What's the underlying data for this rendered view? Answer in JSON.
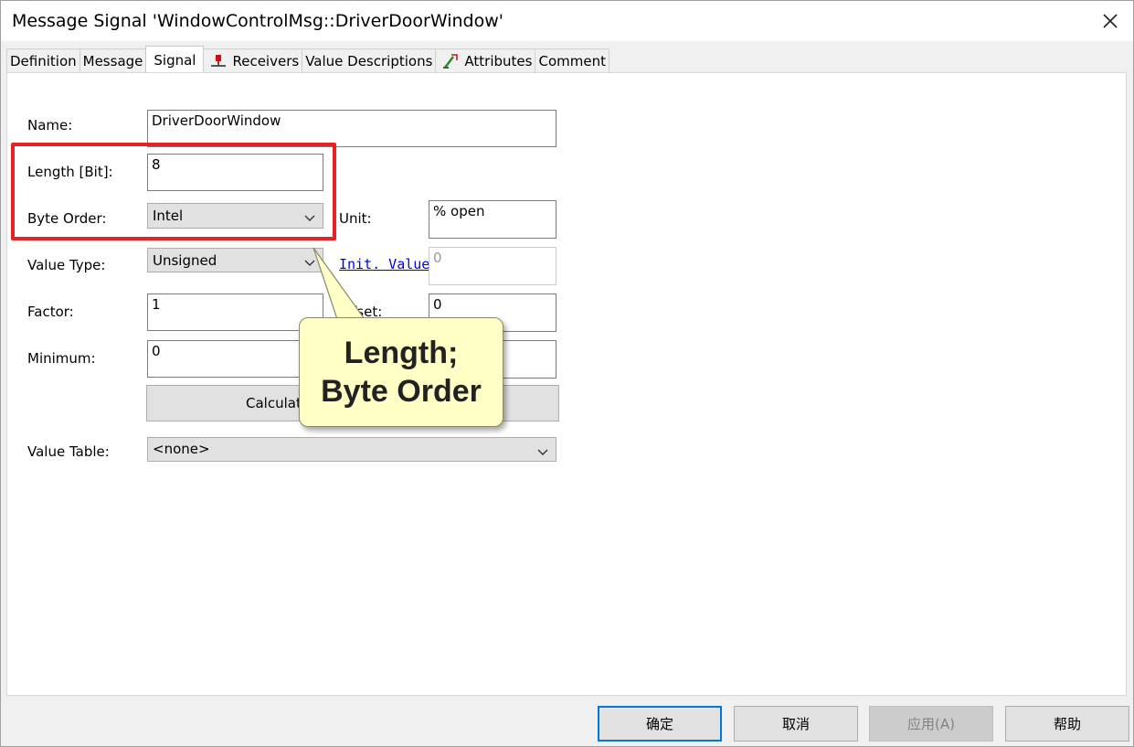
{
  "window": {
    "title": "Message Signal 'WindowControlMsg::DriverDoorWindow'"
  },
  "tabs": [
    {
      "label": "Definition",
      "icon": ""
    },
    {
      "label": "Message",
      "icon": ""
    },
    {
      "label": "Signal",
      "icon": ""
    },
    {
      "label": "Receivers",
      "icon": "receivers-icon"
    },
    {
      "label": "Value Descriptions",
      "icon": ""
    },
    {
      "label": "Attributes",
      "icon": "attributes-icon"
    },
    {
      "label": "Comment",
      "icon": ""
    }
  ],
  "form": {
    "name_label": "Name:",
    "name_value": "DriverDoorWindow",
    "length_label": "Length [Bit]:",
    "length_value": "8",
    "byte_order_label": "Byte Order:",
    "byte_order_value": "Intel",
    "unit_label": "Unit:",
    "unit_value": "% open",
    "value_type_label": "Value Type:",
    "value_type_value": "Unsigned",
    "init_value_link": "Init. Value",
    "init_value": "0",
    "factor_label": "Factor:",
    "factor_value": "1",
    "offset_label": "fset:",
    "offset_value": "0",
    "minimum_label": "Minimum:",
    "minimum_value": "0",
    "calc_button_label": "Calculat",
    "value_table_label": "Value Table:",
    "value_table_value": "<none>"
  },
  "callout": {
    "line1": "Length;",
    "line2": "Byte Order"
  },
  "footer": {
    "ok_label": "确定",
    "cancel_label": "取消",
    "apply_label": "应用(A)",
    "help_label": "帮助"
  },
  "colors": {
    "highlight": "#e62222",
    "callout_bg": "#ffffc6",
    "focus_border": "#0078d7",
    "link": "#0000ee"
  }
}
